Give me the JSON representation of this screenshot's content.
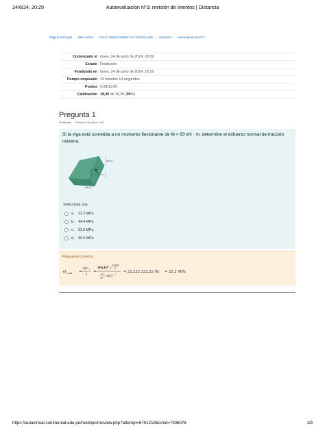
{
  "header": {
    "date": "24/6/24, 20:29",
    "title": "Autoevaluación N°3: revisión de intentos | Distancia"
  },
  "breadcrumb": [
    "Página Principal",
    "Mis cursos",
    "ASUC-01525-26569-VV2-202410-V00",
    "Unidad 3",
    "Autoevaluación N°3"
  ],
  "summary": {
    "rows": [
      {
        "label": "Comenzado el",
        "value": "lunes, 24 de junio de 2024, 20:09"
      },
      {
        "label": "Estado",
        "value": "Finalizado"
      },
      {
        "label": "Finalizado en",
        "value": "lunes, 24 de junio de 2024, 20:29"
      },
      {
        "label": "Tiempo empleado",
        "value": "19 minutos 14 segundos"
      },
      {
        "label": "Puntos",
        "value": "9,00/10,00"
      }
    ],
    "grade_label": "Calificación",
    "grade_main": "18,00",
    "grade_rest": " de 20,00 (",
    "grade_percent": "90",
    "grade_suffix": "%)"
  },
  "question": {
    "title": "Pregunta 1",
    "state": "Finalizado",
    "mark": "Puntúa 1,00 sobre 1,00",
    "text": "Si la viga está sometida a un momento flexionante de M = 50 kN · m, determine el esfuerzo normal de tracción máxima.",
    "figure_labels": {
      "dim_top": "300 mm",
      "dim_mid": "225 mm",
      "dim_bot": "225 mm",
      "moment": "M"
    },
    "prompt": "Seleccione una:",
    "options": [
      {
        "letter": "a.",
        "text": "22.2 MPa"
      },
      {
        "letter": "b.",
        "text": "44.4 MPa"
      },
      {
        "letter": "c.",
        "text": "33.3 MPa"
      },
      {
        "letter": "d.",
        "text": "55.5 MPa"
      }
    ]
  },
  "feedback": {
    "heading": "Respuesta correcta",
    "formula": {
      "lhs": "σ",
      "lhs_sub": "t máx",
      "eq1_num": "Mc",
      "eq1_num_sub": "t",
      "eq1_den": "I",
      "eq2_num_a": "50x10",
      "eq2_num_exp": "6",
      "eq2_num_b": "x",
      "eq2_num_frac_num": "0.300",
      "eq2_num_frac_den": "3",
      "eq2_den_a_num": "0.3",
      "eq2_den_a_den": "36",
      "eq2_den_b": "x0.3",
      "eq2_den_b_exp": "3",
      "result1": "= 22.222 222,22 Pa",
      "result2": "= 22.2 MPa"
    }
  },
  "footer": {
    "url": "https://aulavirtual.continental.edu.pe/mod/quiz/review.php?attempt=6791218&cmid=7936076",
    "page": "1/9"
  },
  "colors": {
    "link": "#0f6cbf",
    "question_bg": "#e7f3f5",
    "feedback_bg": "#fcefdc",
    "feedback_text": "#8e662e"
  }
}
